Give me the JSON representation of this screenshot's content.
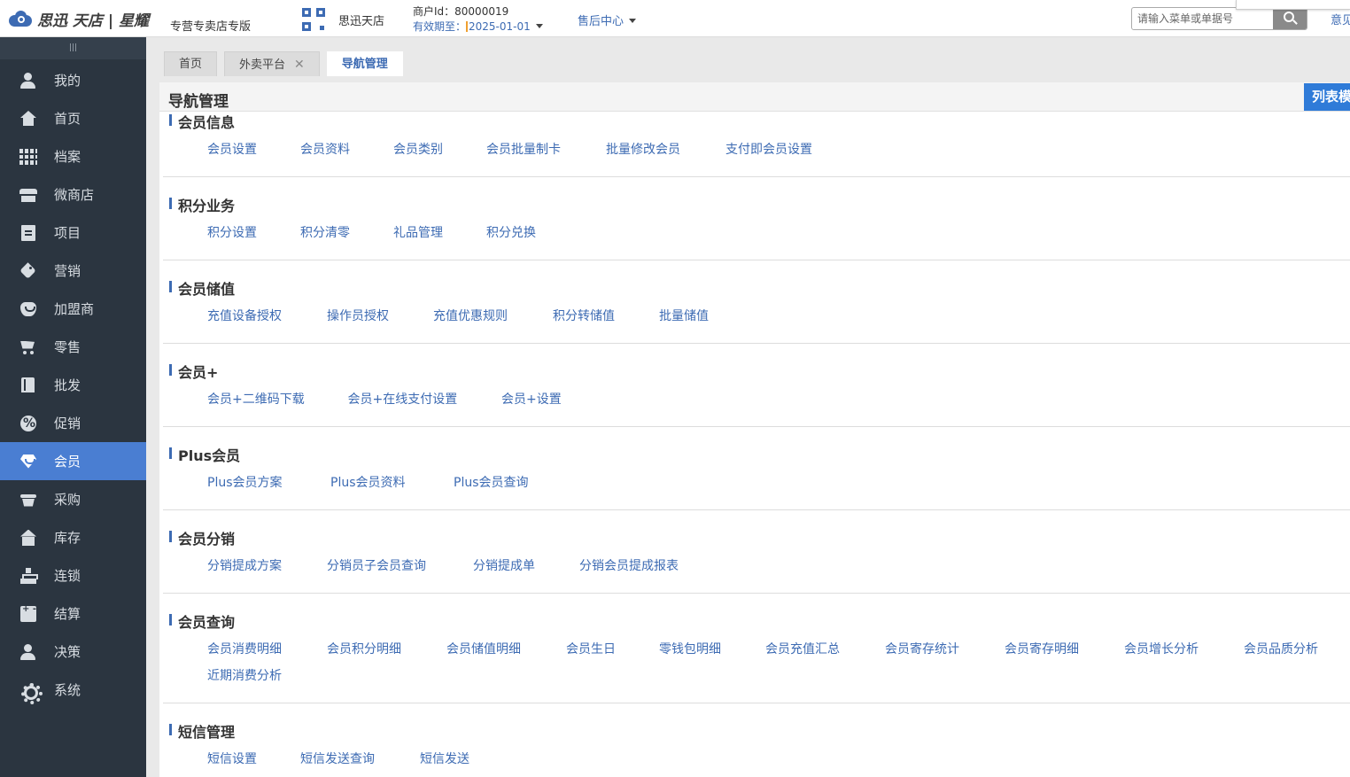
{
  "header": {
    "logo_text": "思迅 天店 | 星耀",
    "edition": "专营专卖店专版",
    "shop_name": "思迅天店",
    "merchant_id": "商户Id：80000019",
    "valid_label": "有效期至：",
    "valid_date": "2025-01-01",
    "after_sales": "售后中心",
    "search_placeholder": "请输入菜单或单据号",
    "feedback": "意见"
  },
  "tabs": [
    {
      "label": "首页"
    },
    {
      "label": "外卖平台",
      "close": "✕"
    },
    {
      "label": "导航管理"
    }
  ],
  "sidebar": {
    "items": [
      {
        "label": "我的",
        "icon": "user-icon"
      },
      {
        "label": "首页",
        "icon": "home-icon"
      },
      {
        "label": "档案",
        "icon": "grid-icon"
      },
      {
        "label": "微商店",
        "icon": "store-icon"
      },
      {
        "label": "项目",
        "icon": "document-icon"
      },
      {
        "label": "营销",
        "icon": "tag-icon"
      },
      {
        "label": "加盟商",
        "icon": "heart-icon"
      },
      {
        "label": "零售",
        "icon": "cart-icon"
      },
      {
        "label": "批发",
        "icon": "book-icon"
      },
      {
        "label": "促销",
        "icon": "percent-icon"
      },
      {
        "label": "会员",
        "icon": "gem-icon",
        "active": true
      },
      {
        "label": "采购",
        "icon": "basket-icon"
      },
      {
        "label": "库存",
        "icon": "warehouse-icon"
      },
      {
        "label": "连锁",
        "icon": "tree-icon"
      },
      {
        "label": "结算",
        "icon": "calculator-icon"
      },
      {
        "label": "决策",
        "icon": "person-icon"
      },
      {
        "label": "系统",
        "icon": "gear-icon"
      }
    ]
  },
  "panel": {
    "title": "导航管理",
    "list_button": "列表模式"
  },
  "sections": [
    {
      "title": "会员信息",
      "links": [
        "会员设置",
        "会员资料",
        "会员类别",
        "会员批量制卡",
        "批量修改会员",
        "支付即会员设置"
      ]
    },
    {
      "title": "积分业务",
      "links": [
        "积分设置",
        "积分清零",
        "礼品管理",
        "积分兑换"
      ]
    },
    {
      "title": "会员储值",
      "links": [
        "充值设备授权",
        "操作员授权",
        "充值优惠规则",
        "积分转储值",
        "批量储值"
      ]
    },
    {
      "title": "会员+",
      "links": [
        "会员+二维码下载",
        "会员+在线支付设置",
        "会员+设置"
      ]
    },
    {
      "title": "Plus会员",
      "links": [
        "Plus会员方案",
        "Plus会员资料",
        "Plus会员查询"
      ]
    },
    {
      "title": "会员分销",
      "links": [
        "分销提成方案",
        "分销员子会员查询",
        "分销提成单",
        "分销会员提成报表"
      ]
    },
    {
      "title": "会员查询",
      "links": [
        "会员消费明细",
        "会员积分明细",
        "会员储值明细",
        "会员生日",
        "零钱包明细",
        "会员充值汇总",
        "会员寄存统计",
        "会员寄存明细",
        "会员增长分析",
        "会员品质分析",
        "近期消费分析"
      ]
    },
    {
      "title": "短信管理",
      "links": [
        "短信设置",
        "短信发送查询",
        "短信发送"
      ]
    }
  ]
}
